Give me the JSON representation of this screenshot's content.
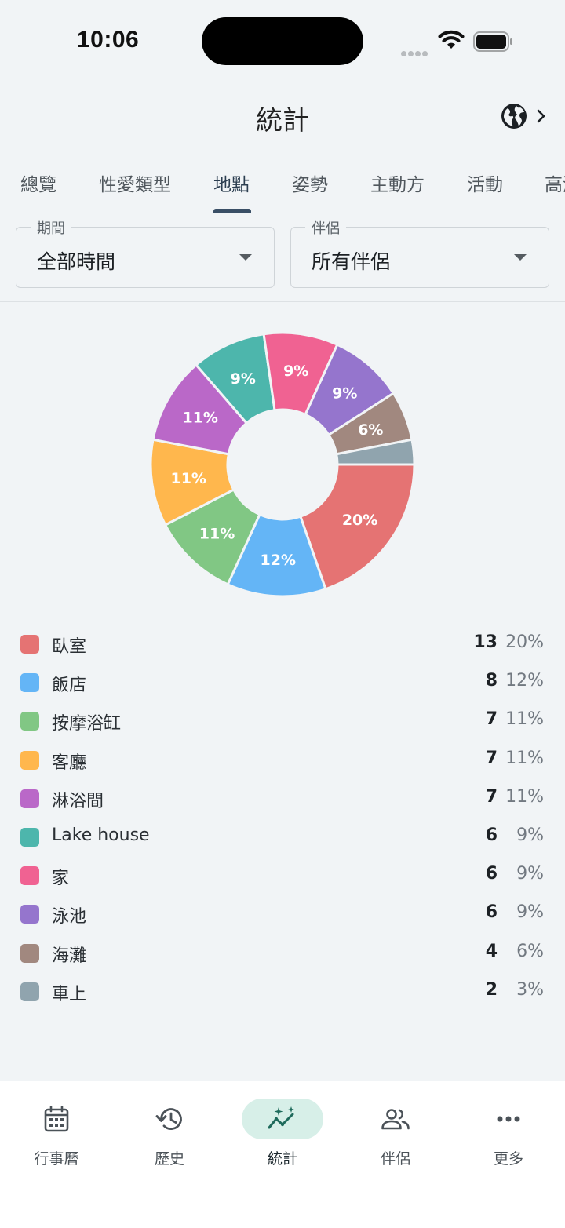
{
  "status_bar": {
    "time": "10:06"
  },
  "header": {
    "title": "統計"
  },
  "tabs": [
    {
      "label": "總覽"
    },
    {
      "label": "性愛類型"
    },
    {
      "label": "地點",
      "active": true
    },
    {
      "label": "姿勢"
    },
    {
      "label": "主動方"
    },
    {
      "label": "活動"
    },
    {
      "label": "高潮"
    }
  ],
  "filters": {
    "period": {
      "label": "期間",
      "value": "全部時間"
    },
    "partner": {
      "label": "伴侶",
      "value": "所有伴侶"
    }
  },
  "chart_data": {
    "type": "pie",
    "donut": true,
    "slices": [
      {
        "name": "臥室",
        "count": 13,
        "percent": "20%",
        "label": "20%",
        "color": "#e57373"
      },
      {
        "name": "飯店",
        "count": 8,
        "percent": "12%",
        "label": "12%",
        "color": "#64b5f6"
      },
      {
        "name": "按摩浴缸",
        "count": 7,
        "percent": "11%",
        "label": "11%",
        "color": "#81c784"
      },
      {
        "name": "客廳",
        "count": 7,
        "percent": "11%",
        "label": "11%",
        "color": "#ffb74d"
      },
      {
        "name": "淋浴間",
        "count": 7,
        "percent": "11%",
        "label": "11%",
        "color": "#ba68c8"
      },
      {
        "name": "Lake house",
        "count": 6,
        "percent": "9%",
        "label": "9%",
        "color": "#4db6ac"
      },
      {
        "name": "家",
        "count": 6,
        "percent": "9%",
        "label": "9%",
        "color": "#f06292"
      },
      {
        "name": "泳池",
        "count": 6,
        "percent": "9%",
        "label": "9%",
        "color": "#9575cd"
      },
      {
        "name": "海灘",
        "count": 4,
        "percent": "6%",
        "label": "6%",
        "color": "#a1887f"
      },
      {
        "name": "車上",
        "count": 2,
        "percent": "3%",
        "label": "",
        "color": "#90a4ae"
      }
    ]
  },
  "bottom_nav": [
    {
      "label": "行事曆",
      "icon": "calendar-icon"
    },
    {
      "label": "歷史",
      "icon": "history-icon"
    },
    {
      "label": "統計",
      "icon": "stats-icon",
      "active": true
    },
    {
      "label": "伴侶",
      "icon": "people-icon"
    },
    {
      "label": "更多",
      "icon": "more-icon"
    }
  ]
}
